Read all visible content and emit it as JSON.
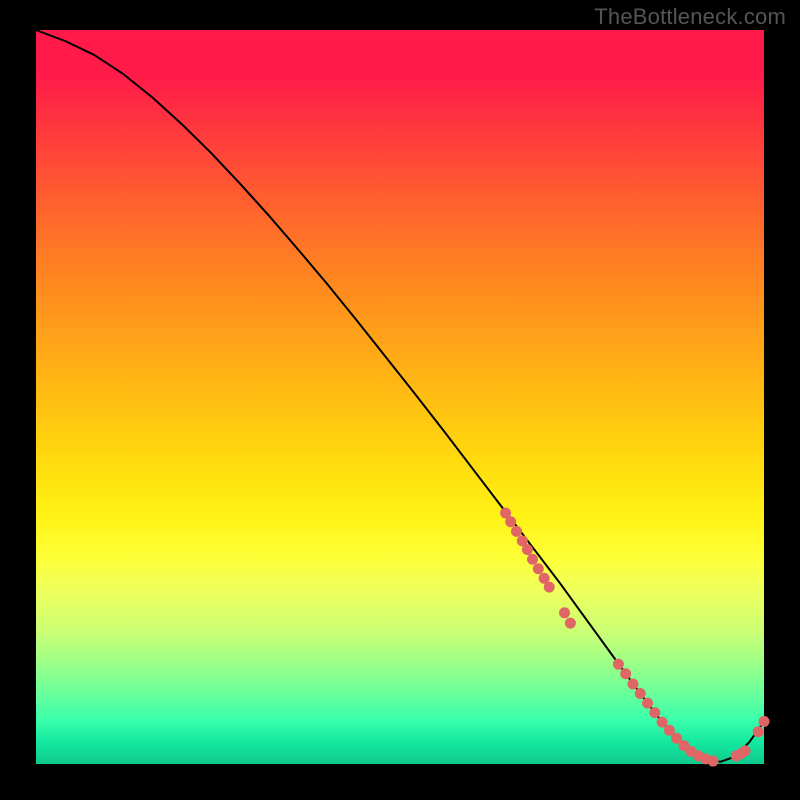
{
  "watermark": "TheBottleneck.com",
  "chart_data": {
    "type": "line",
    "title": "",
    "xlabel": "",
    "ylabel": "",
    "xlim": [
      0,
      100
    ],
    "ylim": [
      0,
      100
    ],
    "curve": {
      "x": [
        0,
        4,
        8,
        12,
        16,
        20,
        24,
        28,
        32,
        36,
        40,
        44,
        48,
        52,
        56,
        60,
        64,
        68,
        72,
        75,
        78,
        81,
        84,
        86,
        88,
        90,
        92,
        94,
        96,
        98,
        100
      ],
      "y": [
        100,
        98.5,
        96.6,
        94.0,
        90.8,
        87.2,
        83.3,
        79.1,
        74.7,
        70.1,
        65.4,
        60.5,
        55.5,
        50.5,
        45.4,
        40.2,
        35.0,
        29.8,
        24.6,
        20.5,
        16.4,
        12.3,
        8.3,
        5.7,
        3.5,
        1.7,
        0.7,
        0.3,
        1.0,
        3.0,
        5.8
      ]
    },
    "points": {
      "segment_a": {
        "x": [
          64.5,
          65.2,
          66.0,
          66.8,
          67.5,
          68.2,
          69.0,
          69.8,
          70.5
        ],
        "y": [
          34.2,
          33.0,
          31.7,
          30.4,
          29.2,
          27.9,
          26.6,
          25.3,
          24.1
        ]
      },
      "segment_b": {
        "x": [
          72.6,
          73.4
        ],
        "y": [
          20.6,
          19.2
        ]
      },
      "segment_c": {
        "x": [
          80.0,
          81.0,
          82.0,
          83.0,
          84.0,
          85.0,
          86.0,
          87.0,
          88.0,
          89.0,
          90.0,
          91.0,
          92.0,
          93.0
        ],
        "y": [
          13.6,
          12.3,
          10.9,
          9.6,
          8.3,
          7.0,
          5.7,
          4.6,
          3.5,
          2.5,
          1.7,
          1.1,
          0.7,
          0.4
        ]
      },
      "segment_d": {
        "x": [
          96.2,
          96.8,
          97.4
        ],
        "y": [
          1.1,
          1.4,
          1.8
        ]
      },
      "segment_e": {
        "x": [
          99.2,
          100.0
        ],
        "y": [
          4.4,
          5.8
        ]
      }
    },
    "colors": {
      "curve": "#000000",
      "points": "#e06666"
    }
  }
}
